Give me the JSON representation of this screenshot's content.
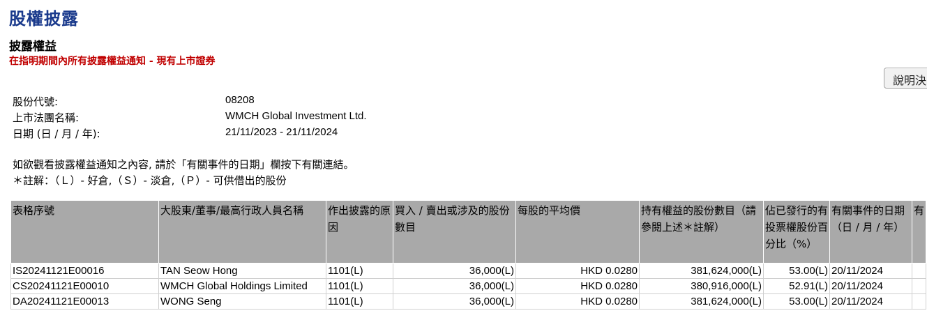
{
  "page": {
    "title": "股權披露",
    "section_title": "披露權益",
    "subtitle": "在指明期間內所有披露權益通知 - 現有上市證券",
    "explain_button": "說明決"
  },
  "info": {
    "stock_code_label": "股份代號:",
    "stock_code": "08208",
    "company_label": "上市法團名稱:",
    "company": "WMCH Global Investment Ltd.",
    "date_label": "日期 (日 / 月 / 年):",
    "date_range": "21/11/2023 - 21/11/2024"
  },
  "notes": {
    "line1": "如欲觀看披露權益通知之內容, 請於「有關事件的日期」欄按下有關連結。",
    "line2": "＊註解：（Ｌ）- 好倉,（Ｓ）- 淡倉,（Ｐ）- 可供借出的股份"
  },
  "table": {
    "headers": [
      "表格序號",
      "大股東/董事/最高行政人員名稱",
      "作出披露的原因",
      "買入 / 賣出或涉及的股份數目",
      "每股的平均價",
      "持有權益的股份數目（請參閱上述＊註解）",
      "佔已發行的有投票權股份百分比（%）",
      "有關事件的日期（日 / 月 / 年）",
      "有"
    ],
    "rows": [
      {
        "form": "IS20241121E00016",
        "name": "TAN Seow Hong",
        "reason": "1101(L)",
        "shares": "36,000(L)",
        "price": "HKD 0.0280",
        "holding": "381,624,000(L)",
        "percent": "53.00(L)",
        "date": "20/11/2024"
      },
      {
        "form": "CS20241121E00010",
        "name": "WMCH Global Holdings Limited",
        "reason": "1101(L)",
        "shares": "36,000(L)",
        "price": "HKD 0.0280",
        "holding": "380,916,000(L)",
        "percent": "52.91(L)",
        "date": "20/11/2024"
      },
      {
        "form": "DA20241121E00013",
        "name": "WONG Seng",
        "reason": "1101(L)",
        "shares": "36,000(L)",
        "price": "HKD 0.0280",
        "holding": "381,624,000(L)",
        "percent": "53.00(L)",
        "date": "20/11/2024"
      }
    ]
  }
}
